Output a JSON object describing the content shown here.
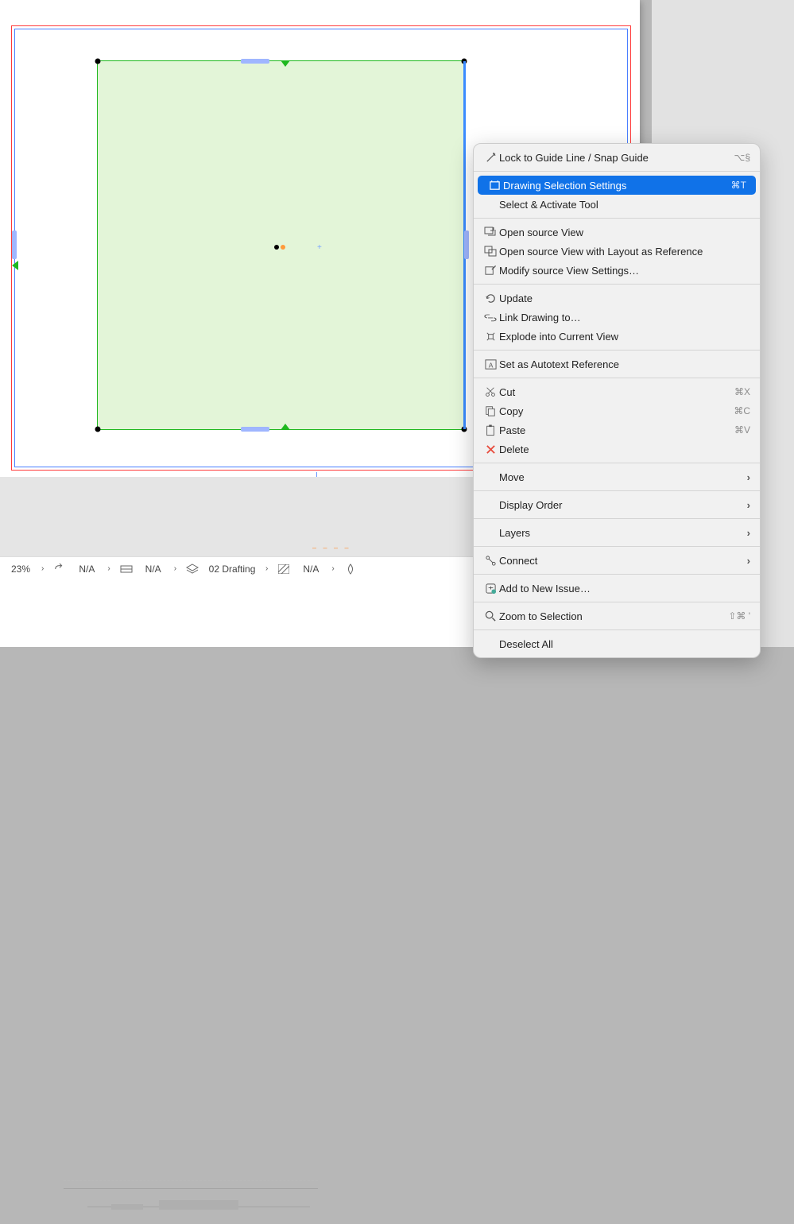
{
  "status": {
    "zoom": "23%",
    "fields": [
      {
        "icon": "arrow-undo-icon",
        "value": "N/A"
      },
      {
        "icon": "grid-rect-icon",
        "value": "N/A"
      },
      {
        "icon": "layers-icon",
        "value": "02 Drafting"
      },
      {
        "icon": "hatch-icon",
        "value": "N/A"
      },
      {
        "icon": "fill-icon",
        "value": ""
      }
    ]
  },
  "menu": {
    "items": [
      {
        "label": "Lock to Guide Line / Snap Guide",
        "shortcut": "⌥§",
        "icon": "wand-icon",
        "highlighted": false
      },
      {
        "sep": true
      },
      {
        "label": "Drawing Selection Settings",
        "shortcut": "⌘T",
        "icon": "settings-frame-icon",
        "highlighted": true
      },
      {
        "label": "Select & Activate Tool",
        "shortcut": "",
        "icon": "",
        "highlighted": false
      },
      {
        "sep": true
      },
      {
        "label": "Open source View",
        "shortcut": "",
        "icon": "open-view-icon",
        "highlighted": false
      },
      {
        "label": "Open source View with Layout as Reference",
        "shortcut": "",
        "icon": "open-view-ref-icon",
        "highlighted": false
      },
      {
        "label": "Modify source View Settings…",
        "shortcut": "",
        "icon": "modify-view-icon",
        "highlighted": false
      },
      {
        "sep": true
      },
      {
        "label": "Update",
        "shortcut": "",
        "icon": "refresh-icon",
        "highlighted": false
      },
      {
        "label": "Link Drawing to…",
        "shortcut": "",
        "icon": "link-icon",
        "highlighted": false
      },
      {
        "label": "Explode into Current View",
        "shortcut": "",
        "icon": "explode-icon",
        "highlighted": false
      },
      {
        "sep": true
      },
      {
        "label": "Set as Autotext Reference",
        "shortcut": "",
        "icon": "autotext-icon",
        "highlighted": false
      },
      {
        "sep": true
      },
      {
        "label": "Cut",
        "shortcut": "⌘X",
        "icon": "cut-icon",
        "highlighted": false
      },
      {
        "label": "Copy",
        "shortcut": "⌘C",
        "icon": "copy-icon",
        "highlighted": false
      },
      {
        "label": "Paste",
        "shortcut": "⌘V",
        "icon": "paste-icon",
        "highlighted": false
      },
      {
        "label": "Delete",
        "shortcut": "",
        "icon": "delete-icon",
        "highlighted": false
      },
      {
        "sep": true
      },
      {
        "label": "Move",
        "shortcut": "",
        "icon": "",
        "submenu": true,
        "highlighted": false
      },
      {
        "sep": true
      },
      {
        "label": "Display Order",
        "shortcut": "",
        "icon": "",
        "submenu": true,
        "highlighted": false
      },
      {
        "sep": true
      },
      {
        "label": "Layers",
        "shortcut": "",
        "icon": "",
        "submenu": true,
        "highlighted": false
      },
      {
        "sep": true
      },
      {
        "label": "Connect",
        "shortcut": "",
        "icon": "connect-icon",
        "submenu": true,
        "highlighted": false
      },
      {
        "sep": true
      },
      {
        "label": "Add to New Issue…",
        "shortcut": "",
        "icon": "issue-icon",
        "highlighted": false
      },
      {
        "sep": true
      },
      {
        "label": "Zoom to Selection",
        "shortcut": "⇧⌘ '",
        "icon": "zoom-icon",
        "highlighted": false
      },
      {
        "sep": true
      },
      {
        "label": "Deselect All",
        "shortcut": "",
        "icon": "",
        "highlighted": false
      }
    ]
  }
}
